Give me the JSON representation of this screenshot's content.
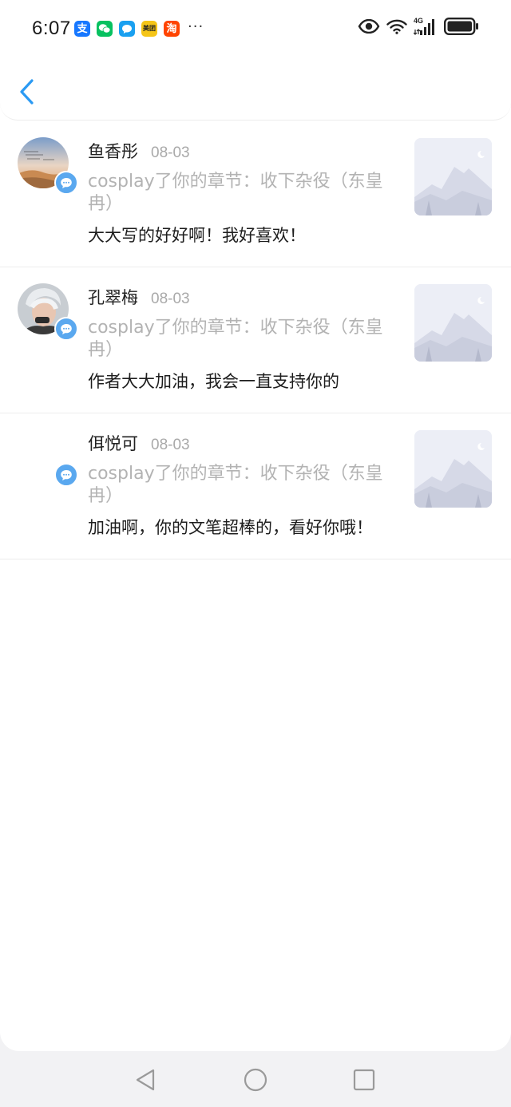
{
  "status_bar": {
    "time": "6:07",
    "notification_apps": [
      {
        "icon": "alipay-icon",
        "glyph": "支",
        "color": "#1677ff"
      },
      {
        "icon": "wechat-icon",
        "glyph": "",
        "color": "#07c160"
      },
      {
        "icon": "message-app-icon",
        "glyph": "",
        "color": "#1aa0f0"
      },
      {
        "icon": "meituan-icon",
        "glyph": "美团",
        "color": "#f5c518"
      },
      {
        "icon": "taobao-icon",
        "glyph": "淘",
        "color": "#ff4400"
      }
    ],
    "more": "···",
    "network": "4G"
  },
  "comments": [
    {
      "name": "鱼香彤",
      "date": "08-03",
      "reference": "cosplay了你的章节：收下杂役（东皇冉）",
      "message": "大大写的好好啊！我好喜欢！",
      "has_avatar": true
    },
    {
      "name": "孔翠梅",
      "date": "08-03",
      "reference": "cosplay了你的章节：收下杂役（东皇冉）",
      "message": "作者大大加油，我会一直支持你的",
      "has_avatar": true
    },
    {
      "name": "佴悦可",
      "date": "08-03",
      "reference": "cosplay了你的章节：收下杂役（东皇冉）",
      "message": "加油啊，你的文笔超棒的，看好你哦！",
      "has_avatar": false
    }
  ],
  "colors": {
    "accent": "#2b9af3",
    "badge": "#5aa8ef",
    "muted_text": "#b3b3b3"
  }
}
